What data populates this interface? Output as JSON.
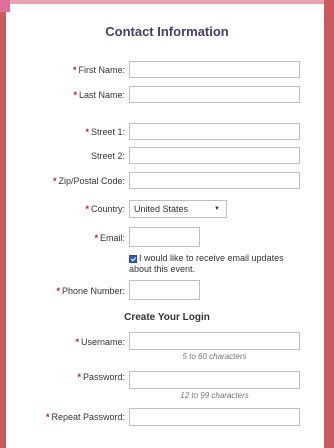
{
  "header": {
    "title": "Contact Information"
  },
  "fields": {
    "first_name": {
      "label": "First Name:",
      "value": ""
    },
    "last_name": {
      "label": "Last Name:",
      "value": ""
    },
    "street1": {
      "label": "Street 1:",
      "value": ""
    },
    "street2": {
      "label": "Street 2:",
      "value": ""
    },
    "zip": {
      "label": "Zip/Postal Code:",
      "value": ""
    },
    "country": {
      "label": "Country:",
      "value": "United States"
    },
    "email": {
      "label": "Email:",
      "value": ""
    },
    "email_updates": {
      "line1": "I would like to receive email updates",
      "line2": "about this event.",
      "checked": true
    },
    "phone": {
      "label": "Phone Number:",
      "value": ""
    }
  },
  "login": {
    "title": "Create Your Login",
    "username": {
      "label": "Username:",
      "hint": "5 to 60 characters"
    },
    "password": {
      "label": "Password:",
      "hint": "12 to 99 characters"
    },
    "repeat_password": {
      "label": "Repeat Password:"
    }
  },
  "required_mark": "*",
  "colors": {
    "frame": "#c95a62",
    "title": "#4a3a66",
    "required": "#b4232e",
    "checkbox": "#2e5fb8"
  }
}
